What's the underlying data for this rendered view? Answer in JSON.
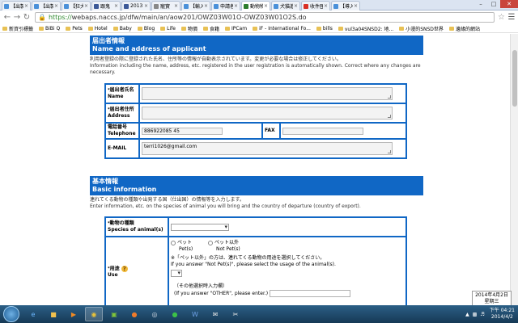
{
  "browser": {
    "tabs": [
      {
        "title": "【出製",
        "color": "#4a90d9",
        "active": false
      },
      {
        "title": "【出製",
        "color": "#4a90d9",
        "active": false
      },
      {
        "title": "【狂犬",
        "color": "#4a90d9",
        "active": false
      },
      {
        "title": "跟鬼",
        "color": "#3b5998",
        "active": false
      },
      {
        "title": "2013 1",
        "color": "#3b5998",
        "active": false
      },
      {
        "title": "寵實",
        "color": "#888888",
        "active": false
      },
      {
        "title": "【輸入",
        "color": "#4a90d9",
        "active": false
      },
      {
        "title": "申請者",
        "color": "#4a90d9",
        "active": false
      },
      {
        "title": "動物物",
        "color": "#2d7d2d",
        "active": true
      },
      {
        "title": "犬貓進",
        "color": "#4a90d9",
        "active": false
      },
      {
        "title": "收件匣",
        "color": "#d93025",
        "active": false
      },
      {
        "title": "【導入",
        "color": "#4a90d9",
        "active": false
      }
    ],
    "url_scheme": "https://",
    "url_rest": "webaps.naccs.jp/dfw/main/an/aow201/OWZ03W01O-OWZ03W01O2S.do",
    "bookmarks": [
      "新資引標籤",
      "BiBi Q",
      "Pets",
      "Hotel",
      "Baby",
      "Blog",
      "Life",
      "物價",
      "食籍",
      "IPCam",
      "iF - International Fo...",
      "bills",
      "vul3a04SNSD2: 地...",
      "小漫的SNSD世界",
      "邊緣的網站"
    ]
  },
  "applicant": {
    "title_jp": "届出者情報",
    "title_en": "Name and address of applicant",
    "desc_jp": "利用者登録の際に登録された氏名、住所等の情報が自動表示されています。変更が必要な場合は修正してください。",
    "desc_en": "Information including the name, address, etc. registered in the user registration is automatically shown. Correct where any changes are necessary.",
    "name_jp": "届出者氏名",
    "name_en": "Name",
    "address_jp": "届出者住所",
    "address_en": "Address",
    "tel_jp": "電話番号",
    "tel_en": "Telephone",
    "tel_value": "886922085 45",
    "fax": "FAX",
    "email": "E-MAIL",
    "email_value": "terri1026@gmail.com",
    "req": "*"
  },
  "basic": {
    "title_jp": "基本情報",
    "title_en": "Basic information",
    "desc_jp": "連れてくる動物の種類や出発する国（仕出国）の情報等を入力します。",
    "desc_en": "Enter information, etc. on the species of animal you will bring and the country of departure (country of export).",
    "species_jp": "動物の種類",
    "species_en": "Species of animal(s)",
    "use_jp": "用途",
    "use_en": "Use",
    "pet_jp": "ペット",
    "pet_en": "Pet(s)",
    "notpet_jp": "ペット以外",
    "notpet_en": "Not Pet(s)",
    "note_jp": "「ペット以外」の方は、連れてくる動物の用途を選択してください。",
    "note_en": "If you answer \"Not Pet(s)\", please select the usage of the animal(s).",
    "other_jp": "（その他選択時入力欄）",
    "other_en": "(If you answer \"OTHER\", please enter.)",
    "note_mark": "※"
  },
  "taskbar": {
    "time": "下午 04:21",
    "date": "2014/4/2",
    "toast_date": "2014年4月2日",
    "toast_day": "星期三"
  }
}
